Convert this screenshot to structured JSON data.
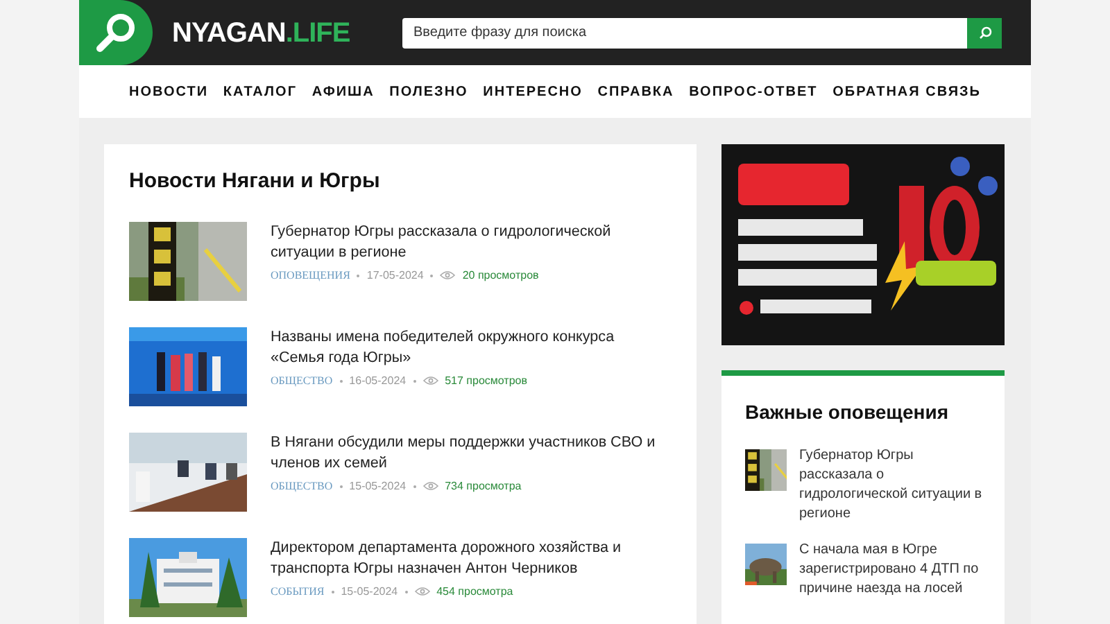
{
  "header": {
    "logo": {
      "text": "NYAGAN",
      "accent": ".LIFE"
    },
    "search": {
      "placeholder": "Введите фразу для поиска"
    }
  },
  "nav": [
    "НОВОСТИ",
    "КАТАЛОГ",
    "АФИША",
    "ПОЛЕЗНО",
    "ИНТЕРЕСНО",
    "СПРАВКА",
    "ВОПРОС-ОТВЕТ",
    "ОБРАТНАЯ СВЯЗЬ"
  ],
  "news": {
    "title": "Новости Нягани и Югры",
    "items": [
      {
        "title": "Губернатор Югры рассказала о гидрологической ситуации в регионе",
        "category": "ОПОВЕЩЕНИЯ",
        "date": "17-05-2024",
        "views": "20 просмотров"
      },
      {
        "title": "Названы имена победителей окружного конкурса «Семья года Югры»",
        "category": "ОБЩЕСТВО",
        "date": "16-05-2024",
        "views": "517 просмотров"
      },
      {
        "title": "В Нягани обсудили меры поддержки участников СВО и членов их семей",
        "category": "ОБЩЕСТВО",
        "date": "15-05-2024",
        "views": "734 просмотра"
      },
      {
        "title": "Директором департамента дорожного хозяйства и транспорта Югры назначен Антон Черников",
        "category": "СОБЫТИЯ",
        "date": "15-05-2024",
        "views": "454 просмотра"
      }
    ]
  },
  "alerts": {
    "title": "Важные оповещения",
    "items": [
      {
        "title": "Губернатор Югры рассказала о гидрологической ситуации в регионе"
      },
      {
        "title": "С начала мая в Югре зарегистрировано 4 ДТП по причине наезда на лосей"
      }
    ]
  }
}
